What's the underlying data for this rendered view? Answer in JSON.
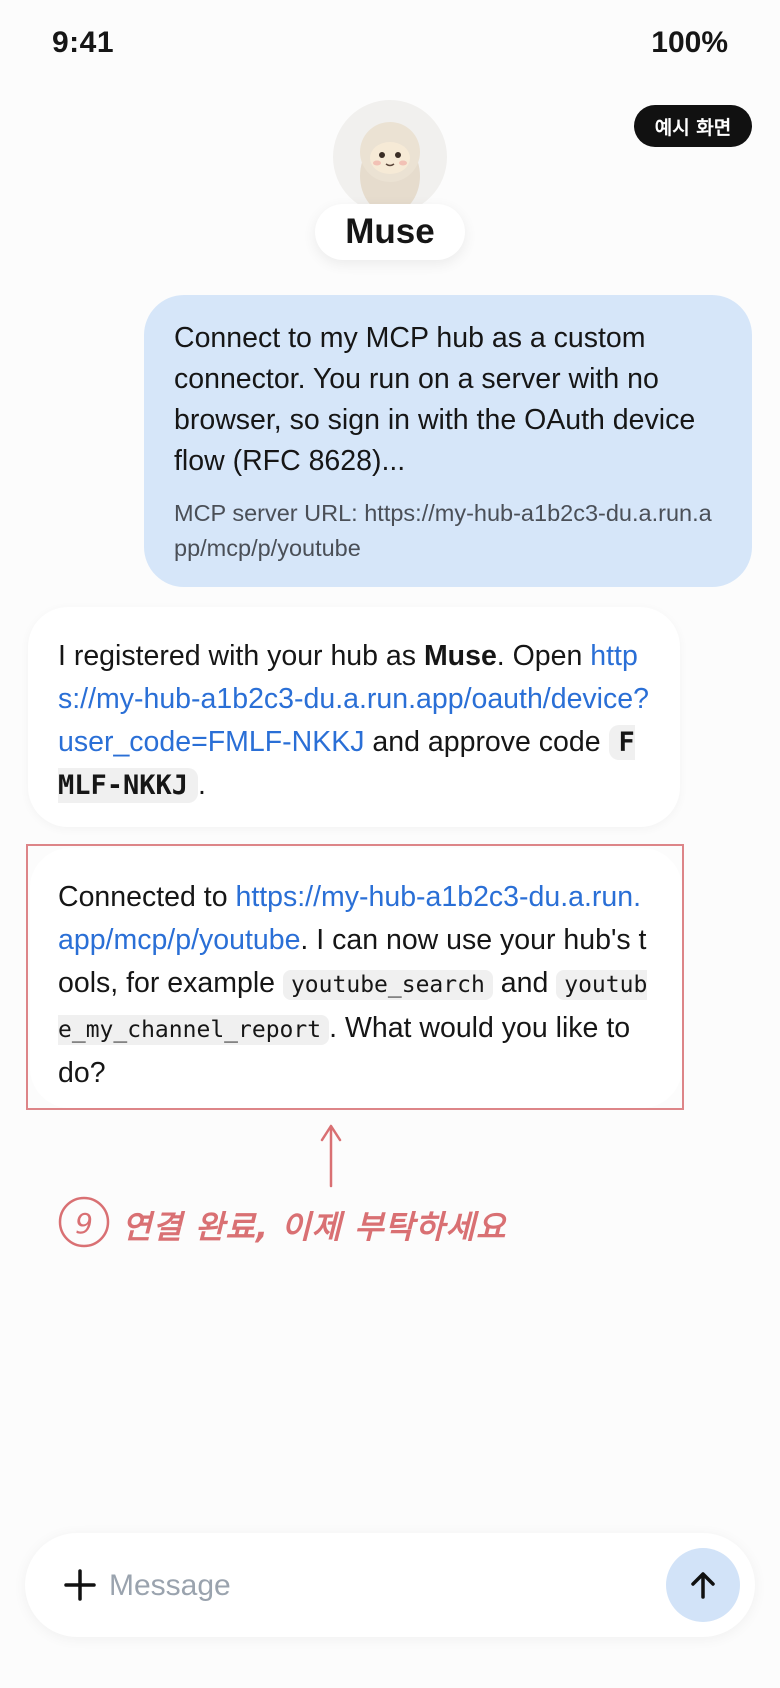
{
  "status": {
    "time": "9:41",
    "battery": "100%"
  },
  "badge": "예시 화면",
  "header": {
    "name": "Muse",
    "avatar_icon": "mascot-avatar-icon"
  },
  "messages": {
    "user": {
      "text": "Connect to my MCP hub as a custom connector. You run on a server with no browser, so sign in with the OAuth device flow (RFC 8628)...",
      "url_line": "MCP server URL: https://my-hub-a1b2c3-du.a.run.app/mcp/p/youtube"
    },
    "bot1": {
      "p1": "I registered with your hub as ",
      "name": "Muse",
      "p2": ". Open ",
      "link": "https://my-hub-a1b2c3-du.a.run.app/oauth/device?user_code=FMLF-NKKJ",
      "p3": " and approve code ",
      "code": "FMLF-NKKJ",
      "p4": "."
    },
    "bot2": {
      "p1": "Connected to ",
      "link": "https://my-hub-a1b2c3-du.a.run.app/mcp/p/youtube",
      "p2": ". I can now use your hub's tools, for example ",
      "tool1": "youtube_search",
      "p3": " and ",
      "tool2": "youtube_my_channel_report",
      "p4": ". What would you like to do?"
    }
  },
  "annotation": {
    "number": "9",
    "text": "연결 완료, 이제 부탁하세요",
    "color": "#d97073"
  },
  "composer": {
    "placeholder": "Message",
    "plus_icon": "plus-icon",
    "send_icon": "arrow-up-icon"
  },
  "colors": {
    "user_bubble": "#d6e6f9",
    "link": "#2a6fd6",
    "send_button": "#d2e3f8"
  }
}
